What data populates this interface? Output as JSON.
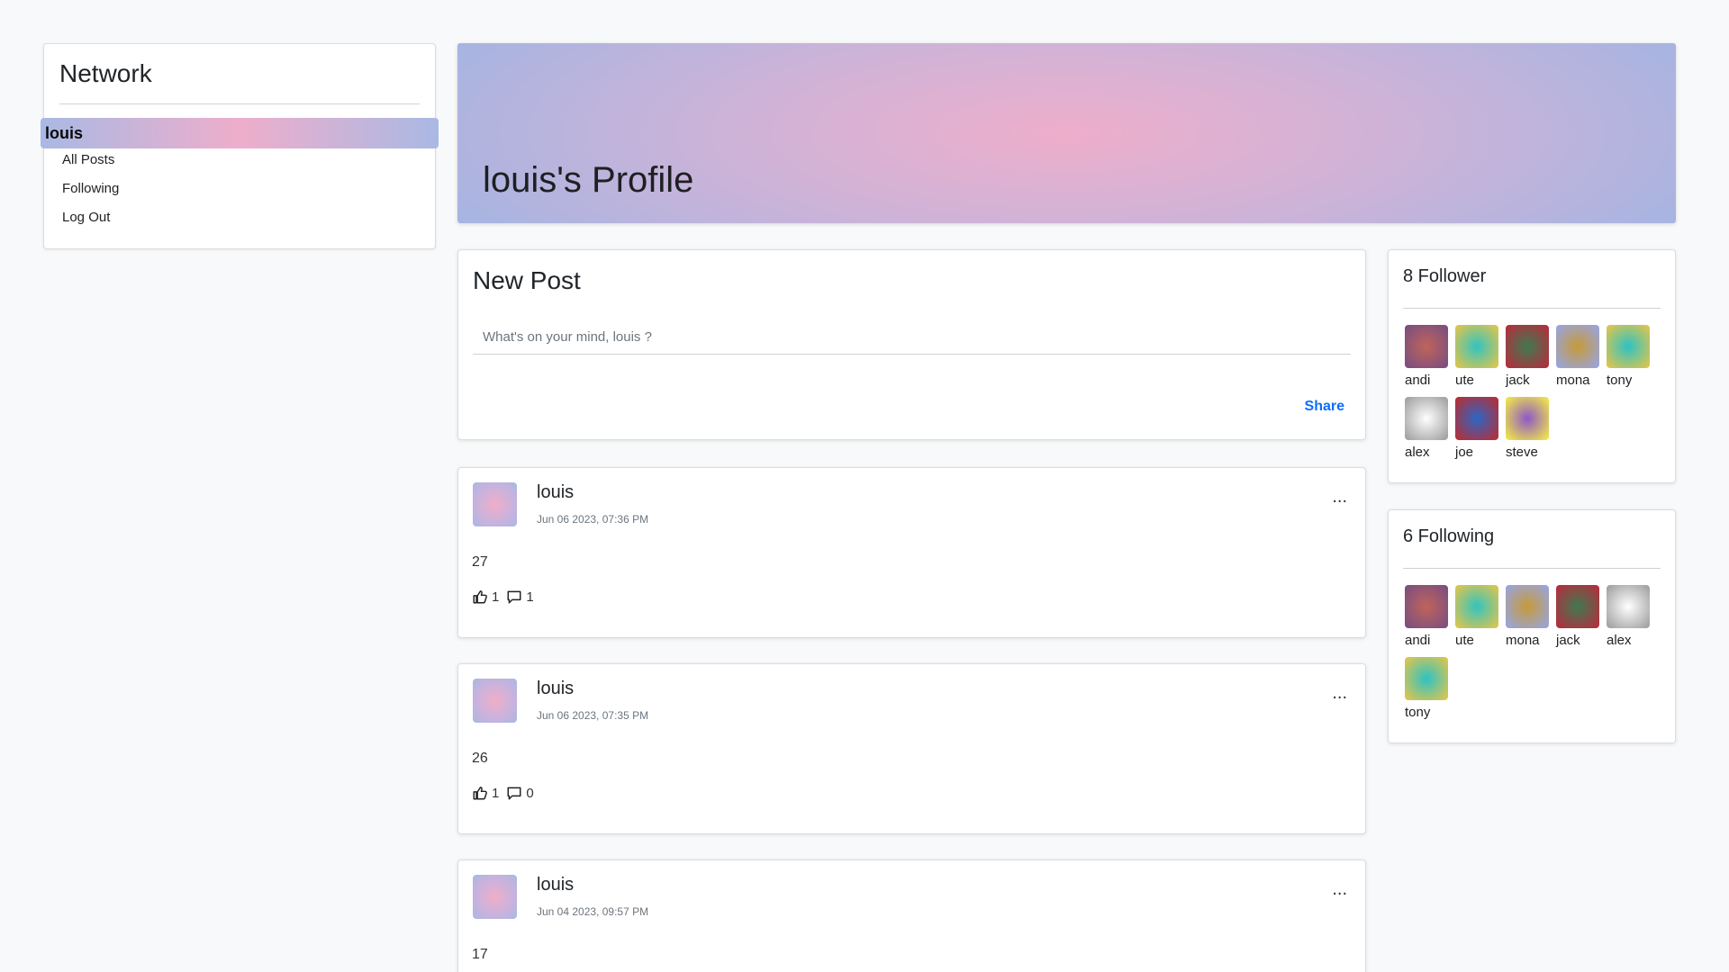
{
  "sidebar": {
    "brand": "Network",
    "active_item": "louis",
    "items": [
      {
        "label": "All Posts"
      },
      {
        "label": "Following"
      },
      {
        "label": "Log Out"
      }
    ]
  },
  "banner": {
    "title": "louis's Profile"
  },
  "new_post": {
    "title": "New Post",
    "placeholder": "What's on your mind, louis ?",
    "share_label": "Share"
  },
  "posts": [
    {
      "author": "louis",
      "date": "Jun 06 2023, 07:36 PM",
      "body": "27",
      "likes": "1",
      "comments": "1",
      "menu": "..."
    },
    {
      "author": "louis",
      "date": "Jun 06 2023, 07:35 PM",
      "body": "26",
      "likes": "1",
      "comments": "0",
      "menu": "..."
    },
    {
      "author": "louis",
      "date": "Jun 04 2023, 09:57 PM",
      "body": "17",
      "likes": "",
      "comments": "",
      "menu": "..."
    }
  ],
  "followers": {
    "title": "8 Follower",
    "users": [
      {
        "name": "andi",
        "colors": [
          "#c0645a",
          "#7d4f7f"
        ]
      },
      {
        "name": "ute",
        "colors": [
          "#33c3c0",
          "#d8c552"
        ]
      },
      {
        "name": "jack",
        "colors": [
          "#3f7a50",
          "#b0303e"
        ]
      },
      {
        "name": "mona",
        "colors": [
          "#c69a3a",
          "#9aa4d8"
        ]
      },
      {
        "name": "tony",
        "colors": [
          "#2ec2c4",
          "#d8c552"
        ]
      },
      {
        "name": "alex",
        "colors": [
          "#ffffff",
          "#a4a4a4"
        ]
      },
      {
        "name": "joe",
        "colors": [
          "#2b66c6",
          "#b2303a"
        ]
      },
      {
        "name": "steve",
        "colors": [
          "#8e58c8",
          "#ede24d"
        ]
      }
    ]
  },
  "following": {
    "title": "6 Following",
    "users": [
      {
        "name": "andi",
        "colors": [
          "#c0645a",
          "#7d4f7f"
        ]
      },
      {
        "name": "ute",
        "colors": [
          "#33c3c0",
          "#d8c552"
        ]
      },
      {
        "name": "mona",
        "colors": [
          "#c69a3a",
          "#9aa4d8"
        ]
      },
      {
        "name": "jack",
        "colors": [
          "#3f7a50",
          "#b0303e"
        ]
      },
      {
        "name": "alex",
        "colors": [
          "#ffffff",
          "#a4a4a4"
        ]
      },
      {
        "name": "tony",
        "colors": [
          "#2ec2c4",
          "#d8c552"
        ]
      }
    ]
  }
}
